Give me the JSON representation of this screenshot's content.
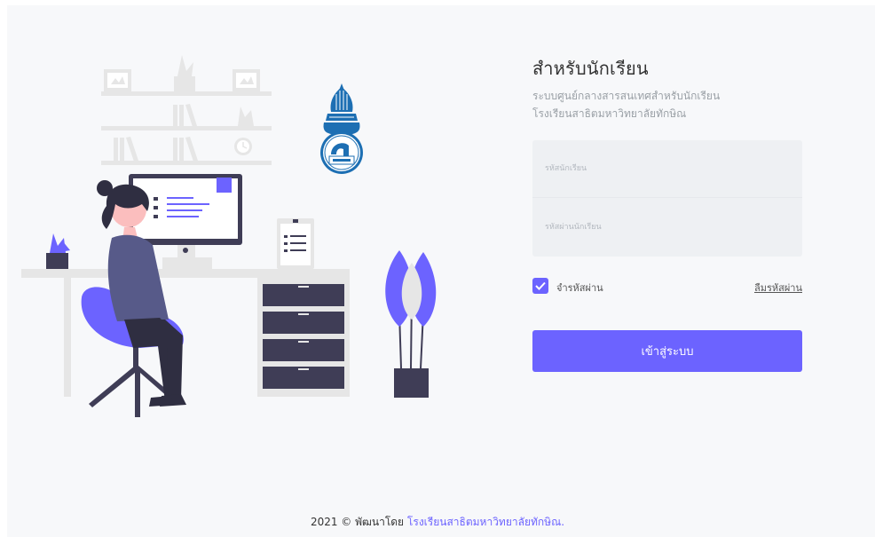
{
  "login": {
    "title": "สำหรับนักเรียน",
    "subtitle_line1": "ระบบศูนย์กลางสารสนเทศสำหรับนักเรียน",
    "subtitle_line2": "โรงเรียนสาธิตมหาวิทยาลัยทักษิณ",
    "student_id_placeholder": "รหัสนักเรียน",
    "password_placeholder": "รหัสผ่านนักเรียน",
    "remember_label": "จำรหัสผ่าน",
    "remember_checked": true,
    "forgot_label": "ลืมรหัสผ่าน",
    "submit_label": "เข้าสู่ระบบ"
  },
  "footer": {
    "prefix": "2021 © พัฒนาโดย",
    "link_text": "โรงเรียนสาธิตมหาวิทยาลัยทักษิณ."
  },
  "colors": {
    "accent": "#6c63ff",
    "background": "#f7f8fa",
    "field_background": "#eef0f3",
    "logo_blue": "#1d6fb3"
  },
  "icons": {
    "logo": "school-emblem-icon",
    "check": "check-icon"
  }
}
